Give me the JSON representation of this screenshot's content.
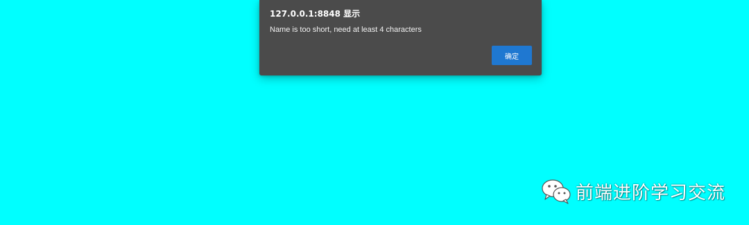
{
  "page": {
    "background_color": "#00ffff"
  },
  "alert_dialog": {
    "title": "127.0.0.1:8848 显示",
    "message": "Name is too short, need at least 4 characters",
    "ok_label": "确定",
    "background_color": "#4b4b4b",
    "button_color": "#1f78d1"
  },
  "watermark": {
    "icon": "wechat-icon",
    "text": "前端进阶学习交流"
  }
}
